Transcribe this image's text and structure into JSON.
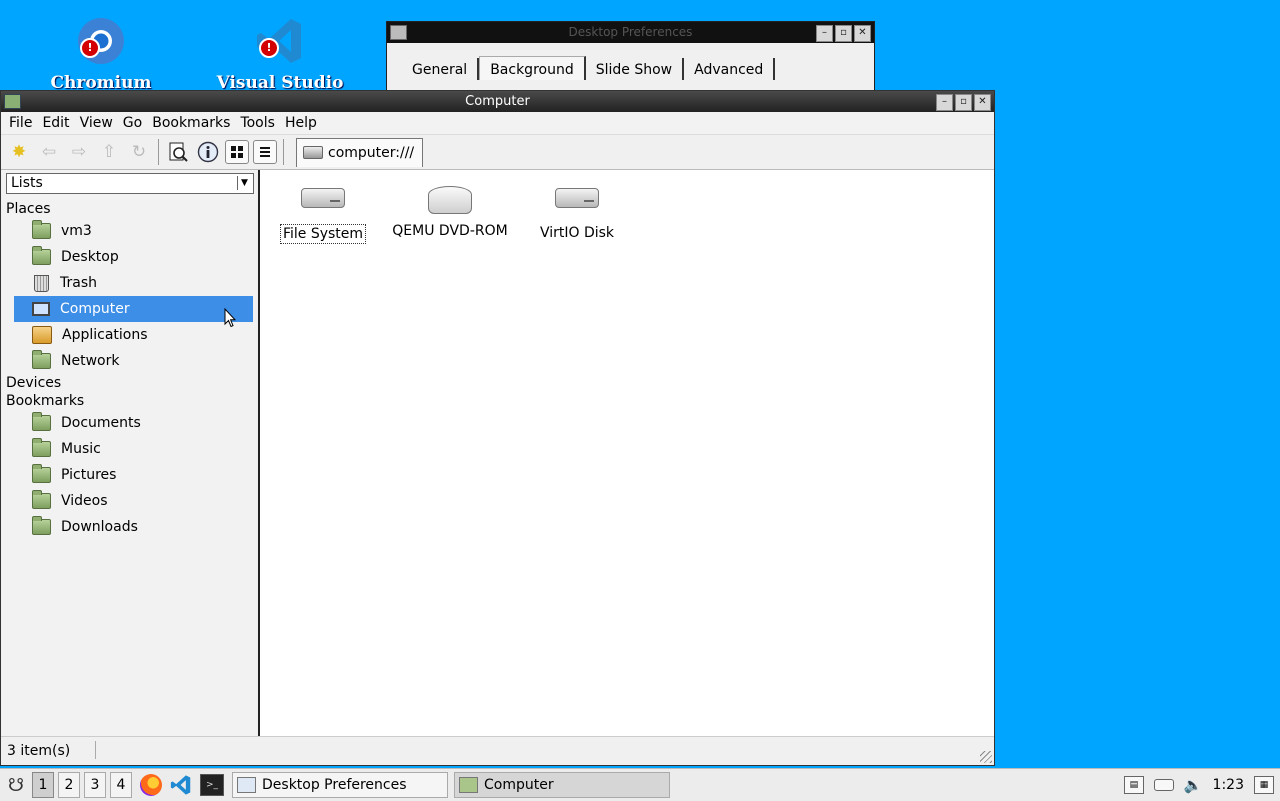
{
  "desktop": {
    "icons": [
      {
        "label": "Chromium",
        "icon": "chromium-icon"
      },
      {
        "label": "Visual Studio",
        "icon": "vscode-icon"
      }
    ]
  },
  "prefs_window": {
    "title": "Desktop Preferences",
    "tabs": [
      {
        "label": "General"
      },
      {
        "label": "Background",
        "active": true
      },
      {
        "label": "Slide Show"
      },
      {
        "label": "Advanced"
      }
    ]
  },
  "main_window": {
    "title": "Computer",
    "menu": [
      "File",
      "Edit",
      "View",
      "Go",
      "Bookmarks",
      "Tools",
      "Help"
    ],
    "location": "computer:///",
    "sidebar": {
      "mode": "Lists",
      "places_label": "Places",
      "places": [
        {
          "label": "vm3",
          "icon": "home-folder-icon"
        },
        {
          "label": "Desktop",
          "icon": "desktop-folder-icon"
        },
        {
          "label": "Trash",
          "icon": "trash-icon"
        },
        {
          "label": "Computer",
          "icon": "computer-icon",
          "selected": true
        },
        {
          "label": "Applications",
          "icon": "applications-icon"
        },
        {
          "label": "Network",
          "icon": "network-folder-icon"
        }
      ],
      "devices_label": "Devices",
      "bookmarks_label": "Bookmarks",
      "bookmarks": [
        {
          "label": "Documents",
          "icon": "documents-folder-icon"
        },
        {
          "label": "Music",
          "icon": "music-folder-icon"
        },
        {
          "label": "Pictures",
          "icon": "pictures-folder-icon"
        },
        {
          "label": "Videos",
          "icon": "videos-folder-icon"
        },
        {
          "label": "Downloads",
          "icon": "downloads-folder-icon"
        }
      ]
    },
    "drives": [
      {
        "label": "File System",
        "icon": "hard-drive-icon"
      },
      {
        "label": "QEMU DVD-ROM",
        "icon": "optical-drive-icon"
      },
      {
        "label": "VirtIO Disk",
        "icon": "hard-drive-icon"
      }
    ],
    "status": "3 item(s)"
  },
  "taskbar": {
    "workspaces": [
      "1",
      "2",
      "3",
      "4"
    ],
    "active_workspace": "1",
    "tasks": [
      {
        "label": "Desktop Preferences"
      },
      {
        "label": "Computer"
      }
    ],
    "clock": "1:23"
  }
}
